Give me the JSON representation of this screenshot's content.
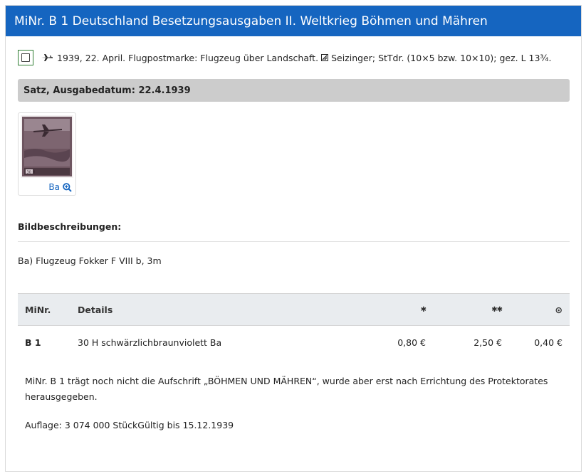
{
  "header": {
    "title": "MiNr. B 1 Deutschland Besetzungsausgaben II. Weltkrieg Böhmen und Mähren"
  },
  "issue": {
    "description_a": "1939, 22. April. Flugpostmarke: Flugzeug über Landschaft.",
    "description_b": "Seizinger; StTdr. (10×5 bzw. 10×10); gez. L 13¾."
  },
  "satz": {
    "label": "Satz, Ausgabedatum: 22.4.1939"
  },
  "thumbnail": {
    "label": "Ba",
    "stamp_value_text": "30 H"
  },
  "bildbeschreibungen": {
    "title": "Bildbeschreibungen:",
    "items": [
      "Ba) Flugzeug Fokker F VIII b, 3m"
    ]
  },
  "table": {
    "headers": {
      "minr": "MiNr.",
      "details": "Details",
      "mint_hinged": "✱",
      "mint_nh": "✱✱",
      "used": "⊙"
    },
    "rows": [
      {
        "minr": "B 1",
        "details": "30 H schwärzlichbraunviolett Ba",
        "mint_hinged": "0,80 €",
        "mint_nh": "2,50 €",
        "used": "0,40 €"
      }
    ]
  },
  "note": "MiNr. B 1 trägt noch nicht die Aufschrift „BÖHMEN UND MÄHREN“, wurde aber erst nach Errichtung des Protektorates herausgegeben.",
  "auflage": "Auflage: 3 074 000 StückGültig bis 15.12.1939",
  "colors": {
    "header_bg": "#1565c0",
    "satz_bg": "#cccccc",
    "table_head_bg": "#e9ecef",
    "checkbox_border": "#2e7d32",
    "link": "#1565c0"
  },
  "icons": [
    "airplane-icon",
    "engraving-icon",
    "zoom-in-icon"
  ]
}
